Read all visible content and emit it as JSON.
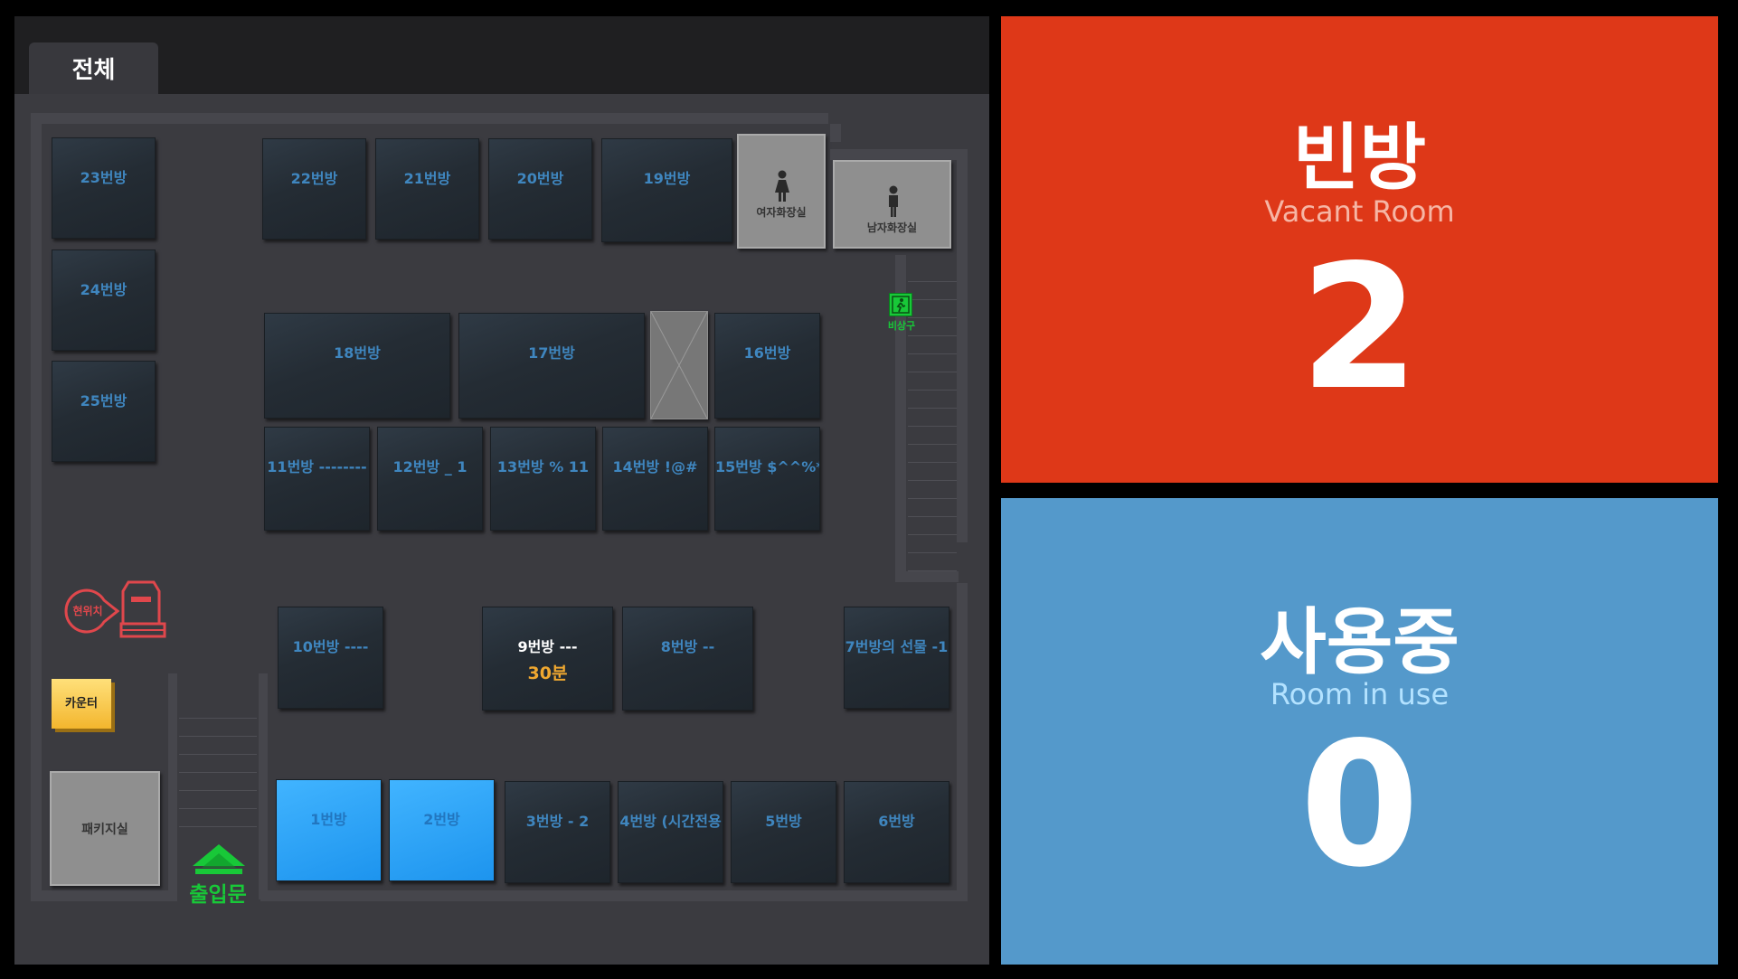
{
  "tabs": [
    {
      "label": "전체"
    }
  ],
  "rooms": {
    "r23": {
      "label": "23번방"
    },
    "r24": {
      "label": "24번방"
    },
    "r25": {
      "label": "25번방"
    },
    "r22": {
      "label": "22번방"
    },
    "r21": {
      "label": "21번방"
    },
    "r20": {
      "label": "20번방"
    },
    "r19": {
      "label": "19번방"
    },
    "r18": {
      "label": "18번방"
    },
    "r17": {
      "label": "17번방"
    },
    "r16": {
      "label": "16번방"
    },
    "r11": {
      "label": "11번방 --------"
    },
    "r12": {
      "label": "12번방 _ 1"
    },
    "r13": {
      "label": "13번방 % 11"
    },
    "r14": {
      "label": "14번방 !@#"
    },
    "r15": {
      "label": "15번방 $^^%*"
    },
    "r10": {
      "label": "10번방 ----"
    },
    "r9": {
      "label": "9번방 ---",
      "time": "30분"
    },
    "r8": {
      "label": "8번방 --"
    },
    "r7": {
      "label": "7번방의 선물 -1"
    },
    "r1": {
      "label": "1번방"
    },
    "r2": {
      "label": "2번방"
    },
    "r3": {
      "label": "3번방 - 2"
    },
    "r4": {
      "label": "4번방 (시간전용"
    },
    "r5": {
      "label": "5번방"
    },
    "r6": {
      "label": "6번방"
    }
  },
  "facilities": {
    "women_restroom": "여자화장실",
    "men_restroom": "남자화장실",
    "emergency_exit": "비상구",
    "current_location": "현위치",
    "counter": "카운터",
    "package_room": "패키지실",
    "entrance": "출입문"
  },
  "status": {
    "vacant": {
      "title": "빈방",
      "subtitle": "Vacant Room",
      "count": "2",
      "color": "#de3818"
    },
    "in_use": {
      "title": "사용중",
      "subtitle": "Room in use",
      "count": "0",
      "color": "#5499cb"
    }
  },
  "colors": {
    "occupied_room": "#2ea4ff",
    "vacant_room": "#26303a",
    "exit_sign": "#18c838",
    "timer_text": "#f0a830",
    "location_marker": "#e0474c",
    "counter": "#f5c542"
  }
}
